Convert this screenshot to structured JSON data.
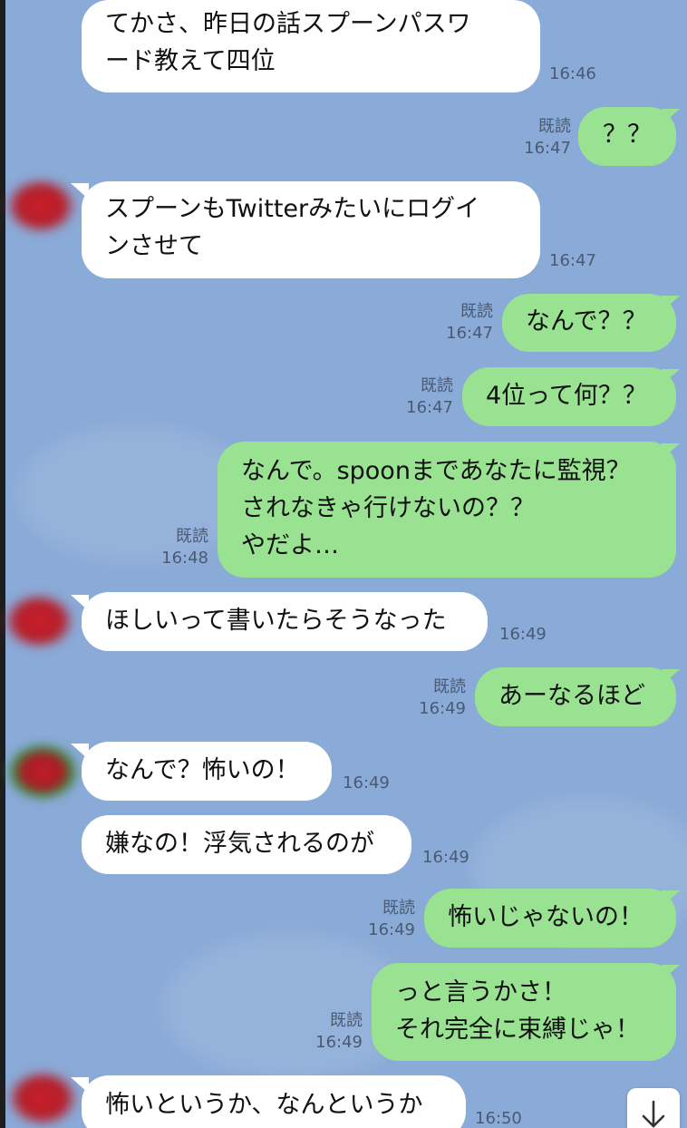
{
  "messages": [
    {
      "side": "recv",
      "text": "てかさ、昨日の話スプーンパスワ\nード教えて四位",
      "time": "16:46"
    },
    {
      "side": "sent",
      "text": "？？",
      "read": "既読",
      "time": "16:47"
    },
    {
      "side": "recv",
      "text": "スプーンもTwitterみたいにログイ\nンさせて",
      "time": "16:47"
    },
    {
      "side": "sent",
      "text": "なんで？？",
      "read": "既読",
      "time": "16:47"
    },
    {
      "side": "sent",
      "text": "4位って何？？",
      "read": "既読",
      "time": "16:47"
    },
    {
      "side": "sent",
      "text": "なんで。spoonまであなたに監視？\nされなきゃ行けないの？？\nやだよ…",
      "read": "既読",
      "time": "16:48"
    },
    {
      "side": "recv",
      "text": "ほしいって書いたらそうなった",
      "time": "16:49"
    },
    {
      "side": "sent",
      "text": "あーなるほど",
      "read": "既読",
      "time": "16:49"
    },
    {
      "side": "recv",
      "text": "なんで？怖いの！",
      "time": "16:49"
    },
    {
      "side": "recv",
      "text": "嫌なの！浮気されるのが",
      "time": "16:49"
    },
    {
      "side": "sent",
      "text": "怖いじゃないの！",
      "read": "既読",
      "time": "16:49"
    },
    {
      "side": "sent",
      "text": "っと言うかさ！\nそれ完全に束縛じゃ！",
      "read": "既読",
      "time": "16:49"
    },
    {
      "side": "recv",
      "text": "怖いというか、なんというか",
      "time": "16:50"
    }
  ],
  "scroll_button": {
    "icon": "arrow-down-icon",
    "glyph": "↓"
  },
  "colors": {
    "background": "#8aaad7",
    "sent_bubble": "#99e291",
    "received_bubble": "#ffffff",
    "meta_text": "#4a5a72"
  }
}
